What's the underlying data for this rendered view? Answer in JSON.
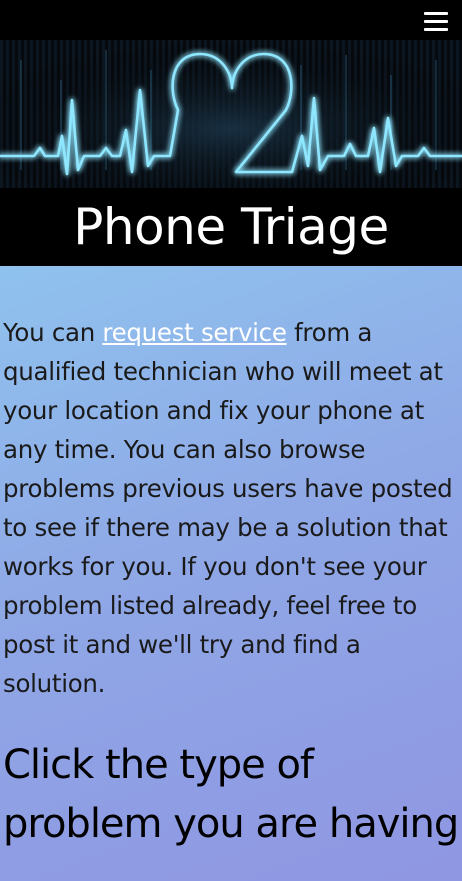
{
  "app": {
    "title": "Phone Triage"
  },
  "topbar": {
    "menu_icon": "hamburger-menu-icon"
  },
  "banner": {
    "image": "heartbeat-heart-line-graphic",
    "colors": {
      "glow": "#7fe0ff",
      "background": "#05080c"
    }
  },
  "intro": {
    "text_before": "You can ",
    "link_label": "request service",
    "text_after": " from a qualified technician who will meet at your location and fix your phone at any time. You can also browse problems previous users have posted to see if there may be a solution that works for you. If you don't see your problem listed already, feel free to post it and we'll try and find a solution."
  },
  "heading": {
    "text": "Click the type of problem you are having"
  },
  "colors": {
    "topbar": "#000000",
    "gradient_start": "#8fc2ee",
    "gradient_end": "#8f96e2",
    "link": "#ffffff"
  }
}
